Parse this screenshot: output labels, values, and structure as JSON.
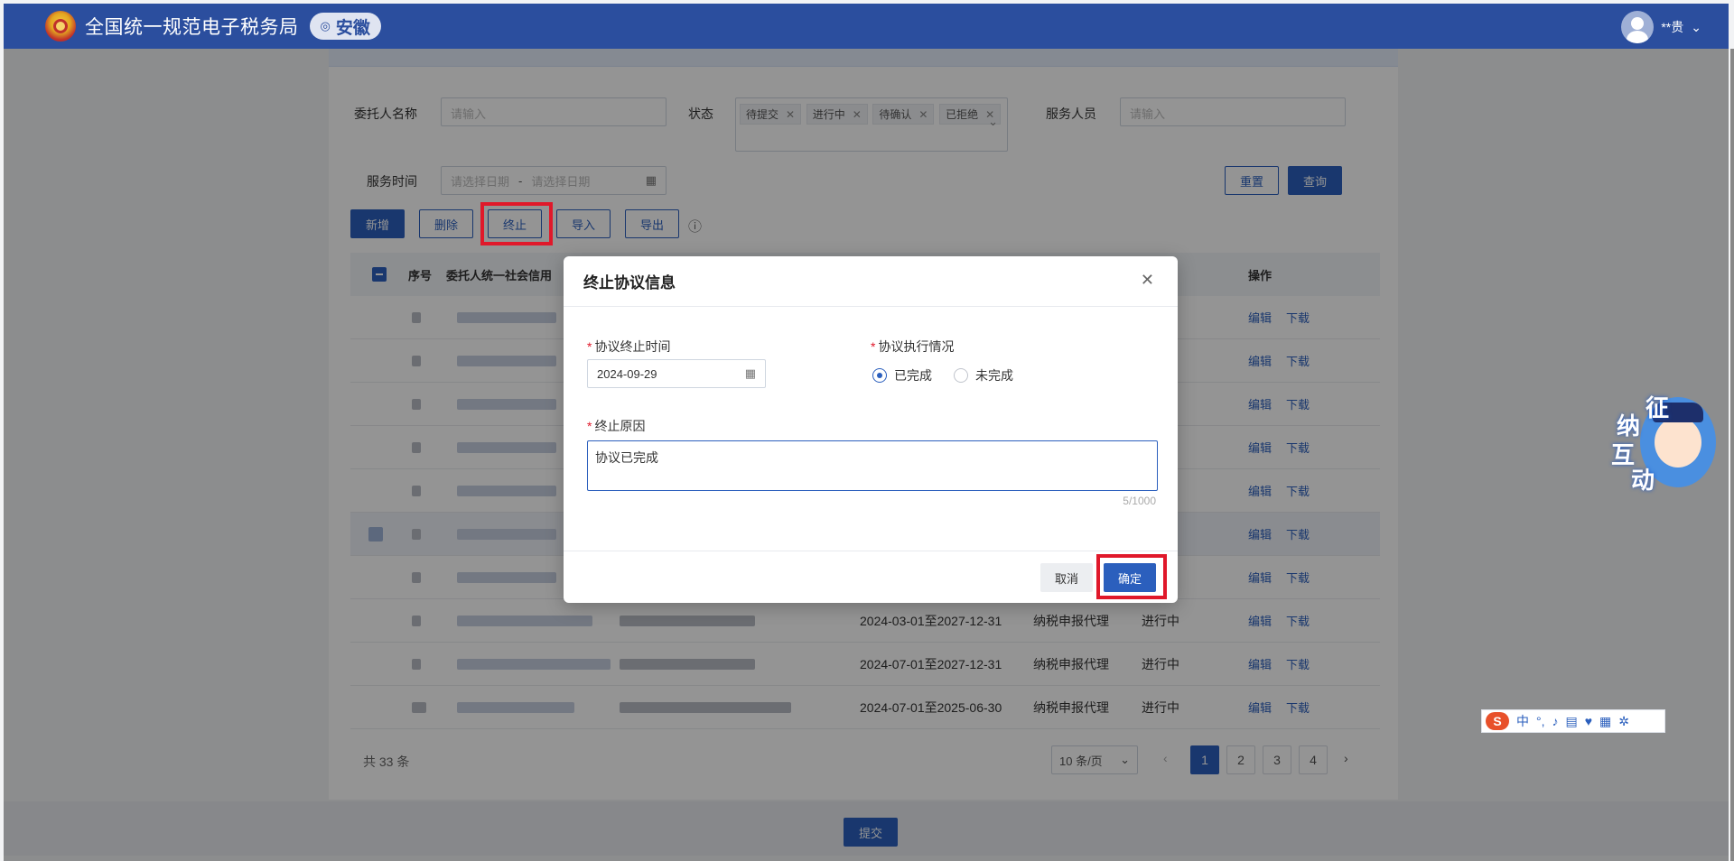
{
  "header": {
    "title": "全国统一规范电子税务局",
    "region": "安徽",
    "user_name": "**贵"
  },
  "filters": {
    "client_name_label": "委托人名称",
    "client_name_placeholder": "请输入",
    "status_label": "状态",
    "status_tags": [
      "待提交",
      "进行中",
      "待确认",
      "已拒绝"
    ],
    "staff_label": "服务人员",
    "staff_placeholder": "请输入",
    "service_time_label": "服务时间",
    "date_start_placeholder": "请选择日期",
    "date_sep": "-",
    "date_end_placeholder": "请选择日期",
    "reset_label": "重置",
    "query_label": "查询"
  },
  "toolbar": {
    "add": "新增",
    "delete": "删除",
    "terminate": "终止",
    "import": "导入",
    "export": "导出"
  },
  "table": {
    "headers": {
      "index": "序号",
      "client_code": "委托人统一社会信用",
      "ops": "操作"
    },
    "op_edit": "编辑",
    "op_download": "下载",
    "visible_rows": [
      {
        "period": "2024-03-01至2027-12-31",
        "type": "纳税申报代理",
        "status": "进行中"
      },
      {
        "period": "2024-07-01至2027-12-31",
        "type": "纳税申报代理",
        "status": "进行中"
      },
      {
        "period": "2024-07-01至2025-06-30",
        "type": "纳税申报代理",
        "status": "进行中"
      }
    ]
  },
  "pagination": {
    "total": "共 33 条",
    "page_size": "10 条/页",
    "pages": [
      "1",
      "2",
      "3",
      "4"
    ],
    "current": "1"
  },
  "footer": {
    "submit": "提交"
  },
  "modal": {
    "title": "终止协议信息",
    "end_time_label": "协议终止时间",
    "end_time_value": "2024-09-29",
    "execution_label": "协议执行情况",
    "option_done": "已完成",
    "option_undone": "未完成",
    "selected": "已完成",
    "reason_label": "终止原因",
    "reason_value": "协议已完成",
    "char_count": "5/1000",
    "cancel": "取消",
    "confirm": "确定"
  },
  "mascot": {
    "c1": "征",
    "c2": "纳",
    "c3": "互",
    "c4": "动"
  },
  "ime": {
    "label": "中"
  },
  "colors": {
    "header": "#2b4e9e",
    "primary": "#2b5fbd",
    "highlight": "#e0182a"
  }
}
